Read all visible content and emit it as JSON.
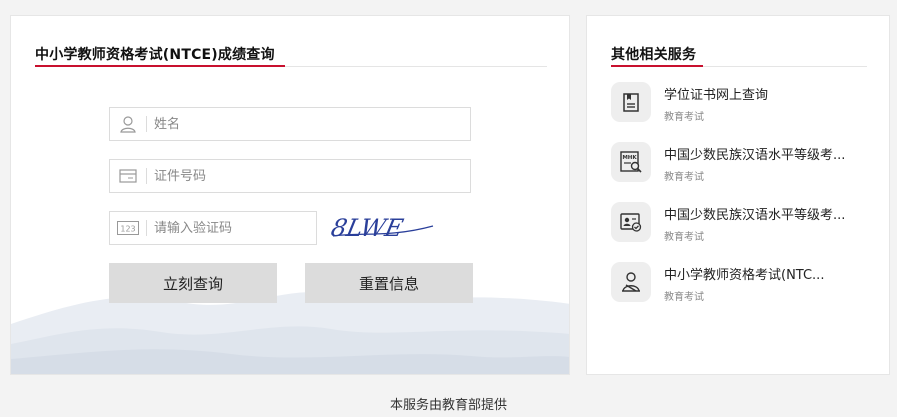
{
  "query_panel": {
    "title": "中小学教师资格考试(NTCE)成绩查询",
    "name_field": {
      "placeholder": "姓名",
      "value": "",
      "icon": "user-icon"
    },
    "id_field": {
      "placeholder": "证件号码",
      "value": "",
      "icon": "id-card-icon"
    },
    "captcha_field": {
      "placeholder": "请输入验证码",
      "value": "",
      "icon": "code-123-icon"
    },
    "captcha_image_text": "8LWE",
    "query_button": "立刻查询",
    "reset_button": "重置信息"
  },
  "services_panel": {
    "title": "其他相关服务",
    "items": [
      {
        "title": "学位证书网上查询",
        "subtitle": "教育考试",
        "icon": "certificate-icon"
      },
      {
        "title": "中国少数民族汉语水平等级考...",
        "subtitle": "教育考试",
        "icon": "mhk-icon"
      },
      {
        "title": "中国少数民族汉语水平等级考...",
        "subtitle": "教育考试",
        "icon": "id-badge-check-icon"
      },
      {
        "title": "中小学教师资格考试(NTC...",
        "subtitle": "教育考试",
        "icon": "teacher-icon"
      }
    ]
  },
  "footer": {
    "text": "本服务由教育部提供"
  },
  "colors": {
    "accent": "#c8102e",
    "captcha_ink": "#2a3f9a",
    "button_bg": "#dcdcdc"
  }
}
